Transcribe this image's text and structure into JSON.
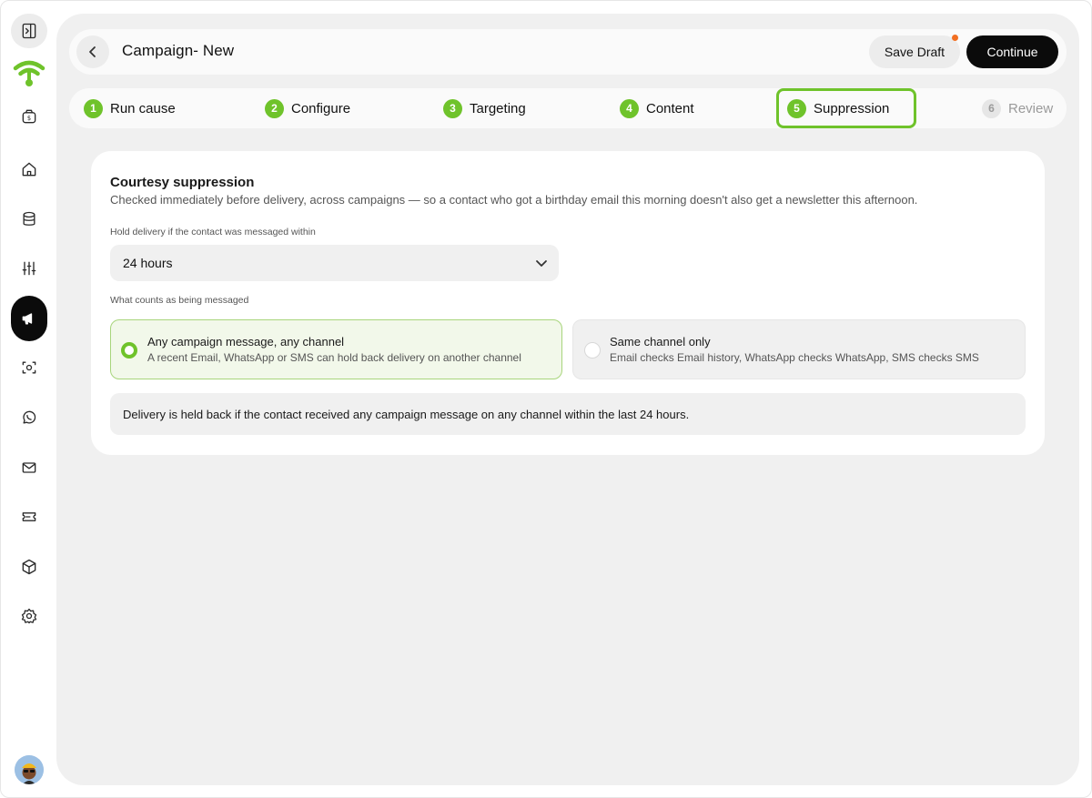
{
  "header": {
    "title": "Campaign- New",
    "save_draft": "Save Draft",
    "continue": "Continue"
  },
  "steps": [
    {
      "num": "1",
      "label": "Run cause",
      "state": "done"
    },
    {
      "num": "2",
      "label": "Configure",
      "state": "done"
    },
    {
      "num": "3",
      "label": "Targeting",
      "state": "done"
    },
    {
      "num": "4",
      "label": "Content",
      "state": "done"
    },
    {
      "num": "5",
      "label": "Suppression",
      "state": "active"
    },
    {
      "num": "6",
      "label": "Review",
      "state": "disabled"
    }
  ],
  "card": {
    "title": "Courtesy suppression",
    "description": "Checked immediately before delivery, across campaigns — so a contact who got a birthday email this morning doesn't also get a newsletter this afternoon.",
    "hold_label": "Hold delivery if the contact was messaged within",
    "hold_value": "24 hours",
    "counts_label": "What counts as being messaged",
    "options": [
      {
        "title": "Any campaign message, any channel",
        "subtitle": "A recent Email, WhatsApp or SMS can hold back delivery on another channel",
        "selected": true
      },
      {
        "title": "Same channel only",
        "subtitle": "Email checks Email history, WhatsApp checks WhatsApp, SMS checks SMS",
        "selected": false
      }
    ],
    "info": "Delivery is held back if the contact received any campaign message on any channel within the last 24 hours."
  },
  "sidebar": {
    "items": [
      "panel-toggle-icon",
      "logo",
      "wallet-icon",
      "home-icon",
      "database-icon",
      "sliders-icon",
      "megaphone-icon",
      "scan-icon",
      "whatsapp-icon",
      "mail-icon",
      "ticket-icon",
      "box-icon",
      "settings-icon"
    ],
    "active": "megaphone-icon"
  },
  "colors": {
    "accent": "#6fc32b",
    "dark": "#0b0b0b",
    "notification": "#f26f22"
  }
}
